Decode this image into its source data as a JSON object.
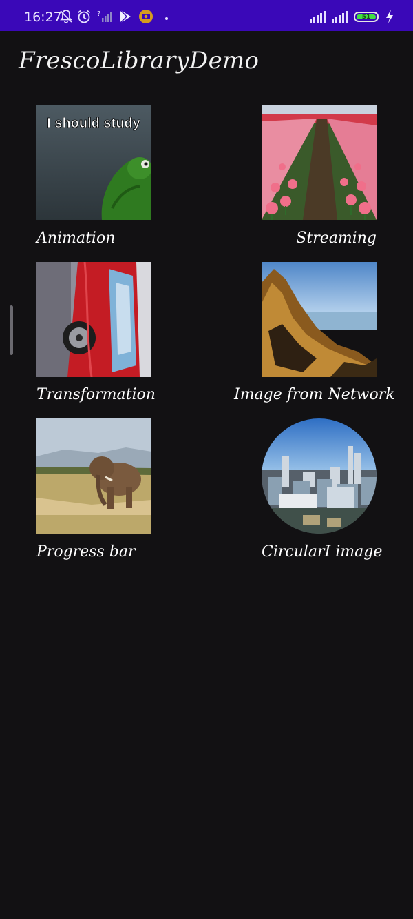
{
  "status_bar": {
    "time": "16:27",
    "battery_level": "51",
    "background_color": "#3a08b8",
    "icons": [
      "notifications-off-icon",
      "alarm-icon",
      "no-data-signal-icon",
      "play-store-icon",
      "media-record-icon",
      "dot-icon",
      "sim1-signal-icon",
      "sim2-signal-icon",
      "battery-icon",
      "charging-icon"
    ]
  },
  "app": {
    "title": "FrescoLibraryDemo"
  },
  "grid": {
    "items": [
      {
        "label": "Animation",
        "image_caption": "I should study",
        "image": "kermit-animated-gif"
      },
      {
        "label": "Streaming",
        "image": "tulip-field"
      },
      {
        "label": "Transformation",
        "image": "red-car-rotated"
      },
      {
        "label": "Image from Network",
        "image": "mountain-landscape"
      },
      {
        "label": "Progress bar",
        "image": "elephant-savanna"
      },
      {
        "label": "CircularI image",
        "image": "city-skyline-circular"
      }
    ]
  }
}
